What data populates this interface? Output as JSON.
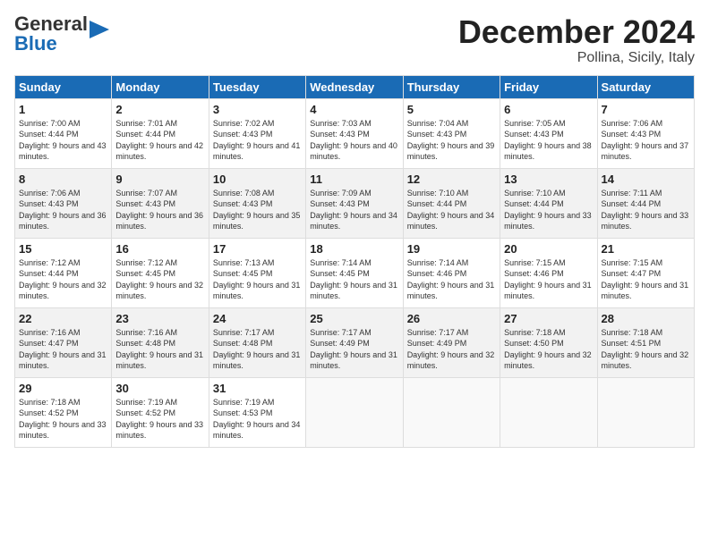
{
  "header": {
    "logo_general": "General",
    "logo_blue": "Blue",
    "title": "December 2024",
    "subtitle": "Pollina, Sicily, Italy"
  },
  "columns": [
    "Sunday",
    "Monday",
    "Tuesday",
    "Wednesday",
    "Thursday",
    "Friday",
    "Saturday"
  ],
  "rows": [
    [
      {
        "day": "1",
        "sunrise": "Sunrise: 7:00 AM",
        "sunset": "Sunset: 4:44 PM",
        "daylight": "Daylight: 9 hours and 43 minutes."
      },
      {
        "day": "2",
        "sunrise": "Sunrise: 7:01 AM",
        "sunset": "Sunset: 4:44 PM",
        "daylight": "Daylight: 9 hours and 42 minutes."
      },
      {
        "day": "3",
        "sunrise": "Sunrise: 7:02 AM",
        "sunset": "Sunset: 4:43 PM",
        "daylight": "Daylight: 9 hours and 41 minutes."
      },
      {
        "day": "4",
        "sunrise": "Sunrise: 7:03 AM",
        "sunset": "Sunset: 4:43 PM",
        "daylight": "Daylight: 9 hours and 40 minutes."
      },
      {
        "day": "5",
        "sunrise": "Sunrise: 7:04 AM",
        "sunset": "Sunset: 4:43 PM",
        "daylight": "Daylight: 9 hours and 39 minutes."
      },
      {
        "day": "6",
        "sunrise": "Sunrise: 7:05 AM",
        "sunset": "Sunset: 4:43 PM",
        "daylight": "Daylight: 9 hours and 38 minutes."
      },
      {
        "day": "7",
        "sunrise": "Sunrise: 7:06 AM",
        "sunset": "Sunset: 4:43 PM",
        "daylight": "Daylight: 9 hours and 37 minutes."
      }
    ],
    [
      {
        "day": "8",
        "sunrise": "Sunrise: 7:06 AM",
        "sunset": "Sunset: 4:43 PM",
        "daylight": "Daylight: 9 hours and 36 minutes."
      },
      {
        "day": "9",
        "sunrise": "Sunrise: 7:07 AM",
        "sunset": "Sunset: 4:43 PM",
        "daylight": "Daylight: 9 hours and 36 minutes."
      },
      {
        "day": "10",
        "sunrise": "Sunrise: 7:08 AM",
        "sunset": "Sunset: 4:43 PM",
        "daylight": "Daylight: 9 hours and 35 minutes."
      },
      {
        "day": "11",
        "sunrise": "Sunrise: 7:09 AM",
        "sunset": "Sunset: 4:43 PM",
        "daylight": "Daylight: 9 hours and 34 minutes."
      },
      {
        "day": "12",
        "sunrise": "Sunrise: 7:10 AM",
        "sunset": "Sunset: 4:44 PM",
        "daylight": "Daylight: 9 hours and 34 minutes."
      },
      {
        "day": "13",
        "sunrise": "Sunrise: 7:10 AM",
        "sunset": "Sunset: 4:44 PM",
        "daylight": "Daylight: 9 hours and 33 minutes."
      },
      {
        "day": "14",
        "sunrise": "Sunrise: 7:11 AM",
        "sunset": "Sunset: 4:44 PM",
        "daylight": "Daylight: 9 hours and 33 minutes."
      }
    ],
    [
      {
        "day": "15",
        "sunrise": "Sunrise: 7:12 AM",
        "sunset": "Sunset: 4:44 PM",
        "daylight": "Daylight: 9 hours and 32 minutes."
      },
      {
        "day": "16",
        "sunrise": "Sunrise: 7:12 AM",
        "sunset": "Sunset: 4:45 PM",
        "daylight": "Daylight: 9 hours and 32 minutes."
      },
      {
        "day": "17",
        "sunrise": "Sunrise: 7:13 AM",
        "sunset": "Sunset: 4:45 PM",
        "daylight": "Daylight: 9 hours and 31 minutes."
      },
      {
        "day": "18",
        "sunrise": "Sunrise: 7:14 AM",
        "sunset": "Sunset: 4:45 PM",
        "daylight": "Daylight: 9 hours and 31 minutes."
      },
      {
        "day": "19",
        "sunrise": "Sunrise: 7:14 AM",
        "sunset": "Sunset: 4:46 PM",
        "daylight": "Daylight: 9 hours and 31 minutes."
      },
      {
        "day": "20",
        "sunrise": "Sunrise: 7:15 AM",
        "sunset": "Sunset: 4:46 PM",
        "daylight": "Daylight: 9 hours and 31 minutes."
      },
      {
        "day": "21",
        "sunrise": "Sunrise: 7:15 AM",
        "sunset": "Sunset: 4:47 PM",
        "daylight": "Daylight: 9 hours and 31 minutes."
      }
    ],
    [
      {
        "day": "22",
        "sunrise": "Sunrise: 7:16 AM",
        "sunset": "Sunset: 4:47 PM",
        "daylight": "Daylight: 9 hours and 31 minutes."
      },
      {
        "day": "23",
        "sunrise": "Sunrise: 7:16 AM",
        "sunset": "Sunset: 4:48 PM",
        "daylight": "Daylight: 9 hours and 31 minutes."
      },
      {
        "day": "24",
        "sunrise": "Sunrise: 7:17 AM",
        "sunset": "Sunset: 4:48 PM",
        "daylight": "Daylight: 9 hours and 31 minutes."
      },
      {
        "day": "25",
        "sunrise": "Sunrise: 7:17 AM",
        "sunset": "Sunset: 4:49 PM",
        "daylight": "Daylight: 9 hours and 31 minutes."
      },
      {
        "day": "26",
        "sunrise": "Sunrise: 7:17 AM",
        "sunset": "Sunset: 4:49 PM",
        "daylight": "Daylight: 9 hours and 32 minutes."
      },
      {
        "day": "27",
        "sunrise": "Sunrise: 7:18 AM",
        "sunset": "Sunset: 4:50 PM",
        "daylight": "Daylight: 9 hours and 32 minutes."
      },
      {
        "day": "28",
        "sunrise": "Sunrise: 7:18 AM",
        "sunset": "Sunset: 4:51 PM",
        "daylight": "Daylight: 9 hours and 32 minutes."
      }
    ],
    [
      {
        "day": "29",
        "sunrise": "Sunrise: 7:18 AM",
        "sunset": "Sunset: 4:52 PM",
        "daylight": "Daylight: 9 hours and 33 minutes."
      },
      {
        "day": "30",
        "sunrise": "Sunrise: 7:19 AM",
        "sunset": "Sunset: 4:52 PM",
        "daylight": "Daylight: 9 hours and 33 minutes."
      },
      {
        "day": "31",
        "sunrise": "Sunrise: 7:19 AM",
        "sunset": "Sunset: 4:53 PM",
        "daylight": "Daylight: 9 hours and 34 minutes."
      },
      null,
      null,
      null,
      null
    ]
  ]
}
